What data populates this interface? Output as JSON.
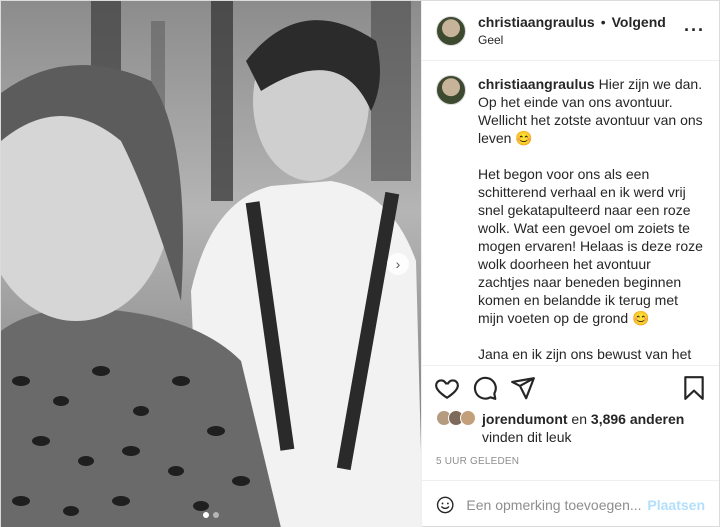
{
  "header": {
    "username": "christiaangraulus",
    "separator": "•",
    "follow_label": "Volgend",
    "location": "Geel",
    "more_icon": "more-horizontal-icon"
  },
  "caption": {
    "username": "christiaangraulus",
    "text": "Hier zijn we dan. Op het einde van ons avontuur. Wellicht het zotste avontuur van ons leven 😊\n\nHet begon voor ons als een schitterend verhaal en ik werd vrij snel gekatapulteerd naar een roze wolk. Wat een gevoel om zoiets te mogen ervaren! Helaas is deze roze wolk doorheen het avontuur zachtjes naar beneden beginnen komen en belandde ik terug met mijn voeten op de grond 😊\n\nJana en ik zijn ons bewust van het feit dat wij een mooi traject aan het afleggen waren binnen Blind"
  },
  "actions": {
    "like_icon": "heart-icon",
    "comment_icon": "comment-icon",
    "share_icon": "send-icon",
    "save_icon": "bookmark-icon"
  },
  "likes": {
    "user": "jorendumont",
    "middle": " en ",
    "count": "3,896 anderen",
    "suffix": "vinden dit leuk"
  },
  "timestamp": "5 UUR GELEDEN",
  "comment": {
    "placeholder": "Een opmerking toevoegen...",
    "post_label": "Plaatsen"
  },
  "carousel": {
    "current": 1,
    "total": 2
  }
}
